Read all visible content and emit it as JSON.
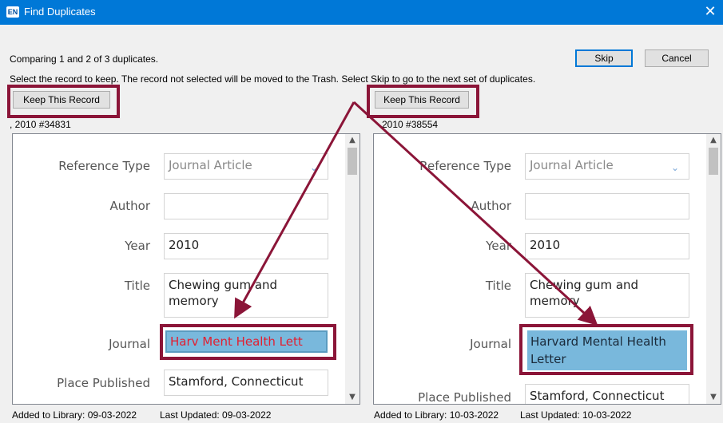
{
  "window": {
    "title": "Find Duplicates",
    "icon_text": "EN",
    "close_glyph": "✕"
  },
  "status": {
    "comparing": "Comparing 1 and 2 of 3 duplicates.",
    "instructions": "Select the record to keep. The record not selected will be moved to the Trash. Select Skip to go to the next set of duplicates."
  },
  "buttons": {
    "skip": "Skip",
    "cancel": "Cancel",
    "keep": "Keep This Record"
  },
  "accent_color": "#8b1538",
  "labels": {
    "reference_type": "Reference Type",
    "author": "Author",
    "year": "Year",
    "title": "Title",
    "journal": "Journal",
    "place_published": "Place Published"
  },
  "left": {
    "record_id": ", 2010 #34831",
    "reference_type": "Journal Article",
    "author": "",
    "year": "2010",
    "title": "Chewing gum and memory",
    "journal": "Harv Ment Health Lett",
    "place_published": "Stamford, Connecticut",
    "added": "Added to Library: 09-03-2022",
    "updated": "Last Updated: 09-03-2022"
  },
  "right": {
    "record_id": "2010 #38554",
    "reference_type": "Journal Article",
    "author": "",
    "year": "2010",
    "title": "Chewing gum and memory",
    "journal": "Harvard Mental Health Letter",
    "place_published": "Stamford, Connecticut",
    "added": "Added to Library: 10-03-2022",
    "updated": "Last Updated: 10-03-2022"
  }
}
